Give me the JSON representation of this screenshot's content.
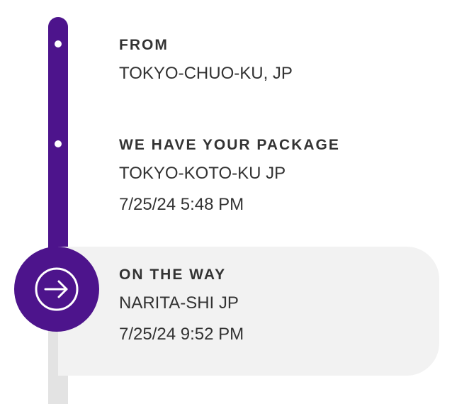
{
  "timeline": {
    "events": [
      {
        "title": "FROM",
        "location": "TOKYO-CHUO-KU, JP",
        "state": "completed"
      },
      {
        "title": "WE HAVE YOUR PACKAGE",
        "location": "TOKYO-KOTO-KU JP",
        "datetime": "7/25/24 5:48 PM",
        "state": "completed"
      },
      {
        "title": "ON THE WAY",
        "location": "NARITA-SHI JP",
        "datetime": "7/25/24 9:52 PM",
        "state": "current",
        "icon": "arrow-right-icon"
      }
    ]
  },
  "colors": {
    "accent": "#4d148c",
    "pending_track": "#e3e3e3",
    "current_background": "#f2f2f2",
    "text": "#333333"
  }
}
